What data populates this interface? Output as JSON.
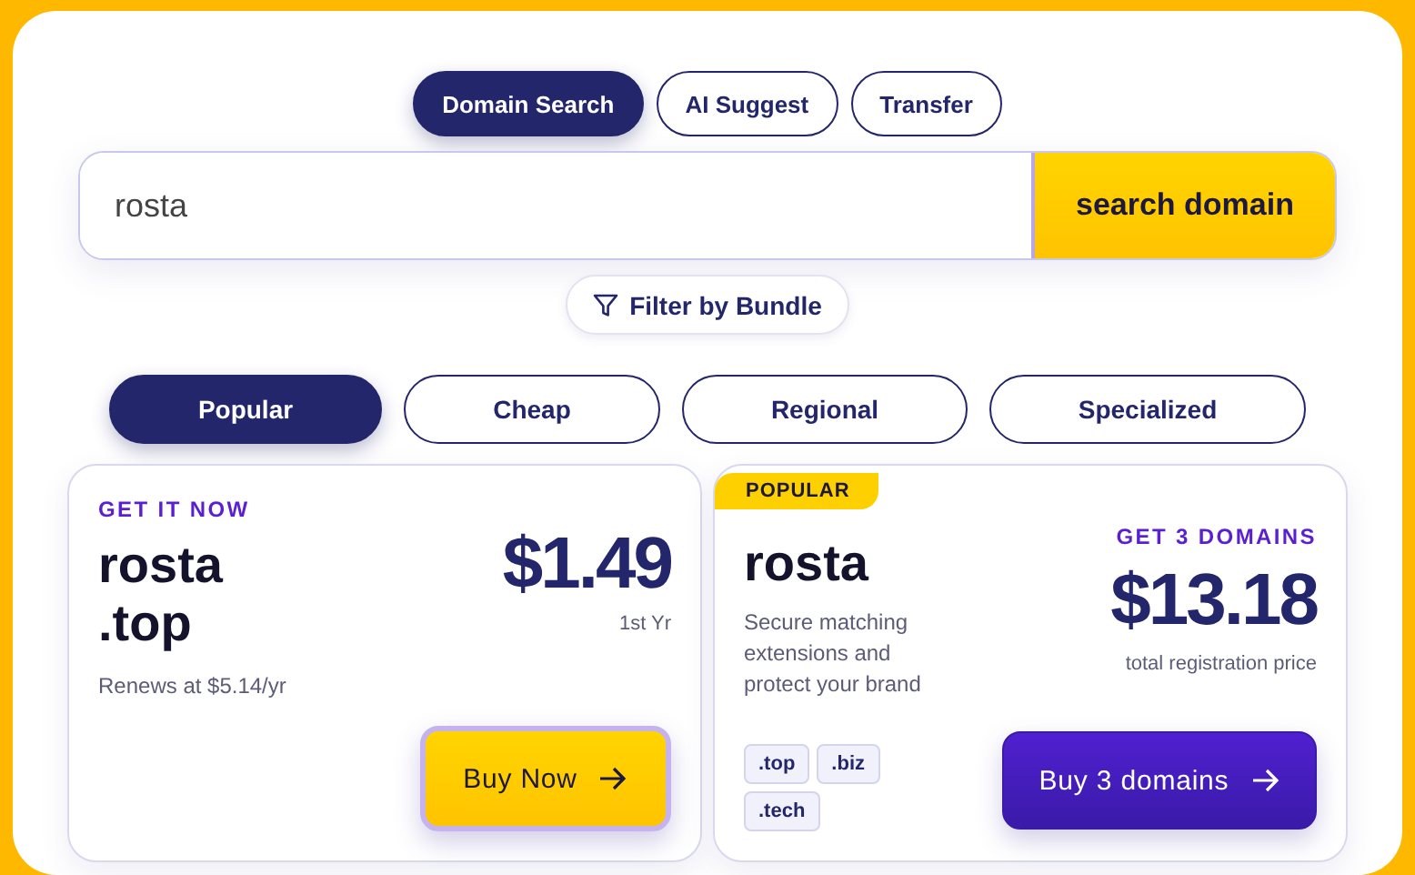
{
  "mode_tabs": [
    {
      "label": "Domain Search",
      "selected": true
    },
    {
      "label": "AI Suggest",
      "selected": false
    },
    {
      "label": "Transfer",
      "selected": false
    }
  ],
  "search": {
    "value": "rosta",
    "button": "search domain"
  },
  "filter_button": "Filter by Bundle",
  "category_tabs": [
    {
      "label": "Popular",
      "selected": true
    },
    {
      "label": "Cheap",
      "selected": false
    },
    {
      "label": "Regional",
      "selected": false
    },
    {
      "label": "Specialized",
      "selected": false
    }
  ],
  "cards": [
    {
      "kind": "single",
      "eyebrow": "GET IT NOW",
      "name": "rosta",
      "extension": ".top",
      "price": "$1.49",
      "price_note": "1st Yr",
      "renewal": "Renews at $5.14/yr",
      "button": "Buy Now"
    },
    {
      "kind": "bundle",
      "badge": "POPULAR",
      "name": "rosta",
      "description": "Secure matching extensions and protect your brand",
      "eyebrow": "GET 3 DOMAINS",
      "price": "$13.18",
      "price_note": "total registration price",
      "extensions": [
        ".top",
        ".biz",
        ".tech"
      ],
      "button": "Buy 3 domains"
    }
  ]
}
